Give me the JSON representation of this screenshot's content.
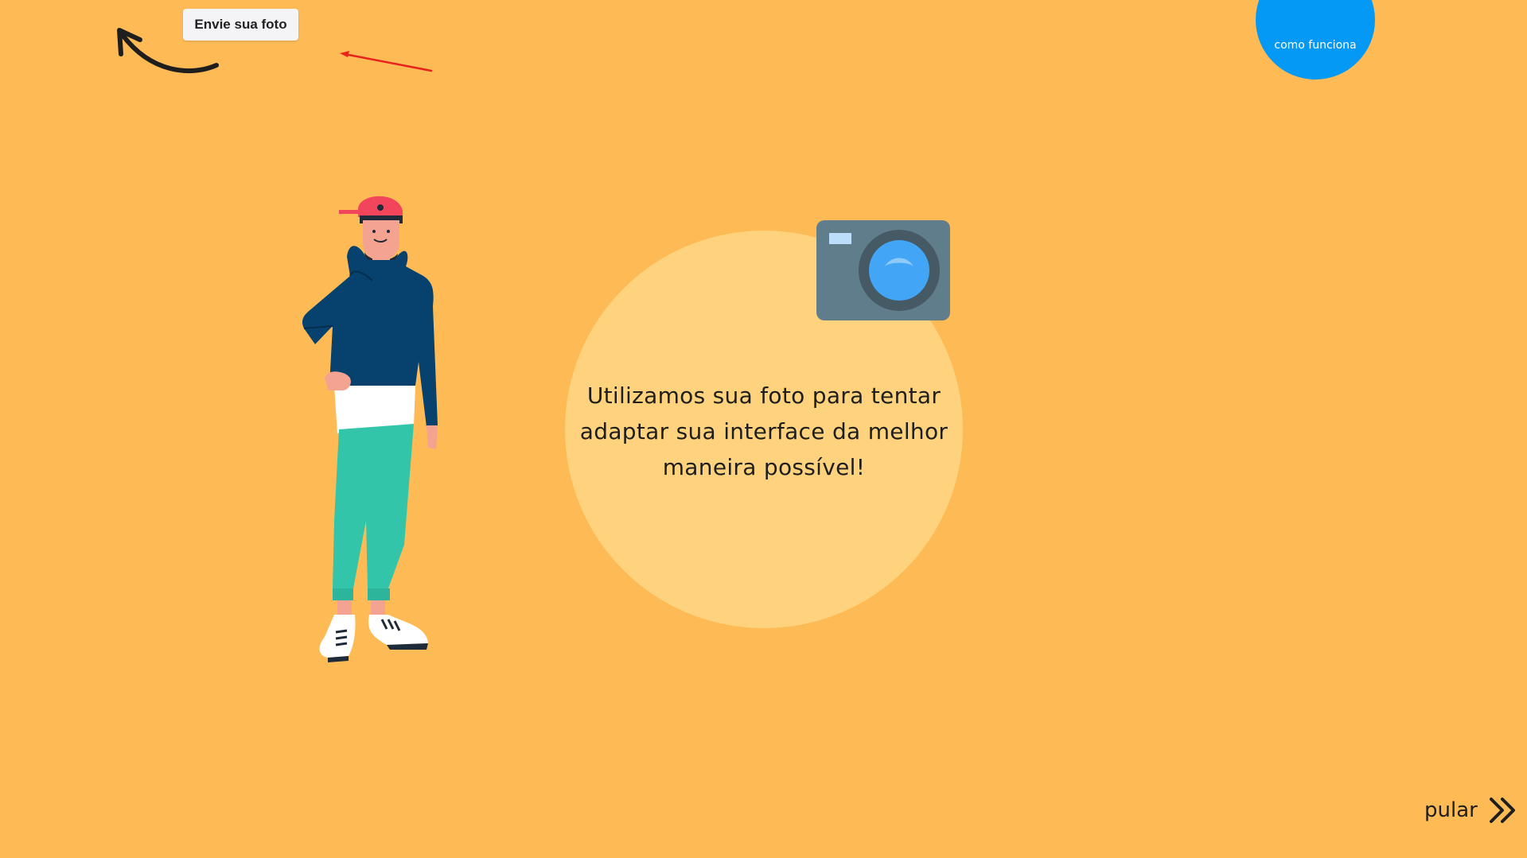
{
  "header": {
    "upload_label": "Envie sua foto",
    "how_label": "como funciona"
  },
  "main": {
    "info_text": "Utilizamos sua foto para tentar adaptar sua interface da melhor maneira possível!"
  },
  "footer": {
    "skip_label": "pular"
  },
  "icons": {
    "curved_arrow": "curved-arrow-icon",
    "red_arrow": "pointer-arrow-icon",
    "camera": "camera-icon",
    "skip": "double-chevron-right-icon"
  },
  "colors": {
    "background": "#FEBB55",
    "circle": "#FFD27E",
    "accent_blue": "#0399F5",
    "arrow_red": "#E8231E"
  }
}
